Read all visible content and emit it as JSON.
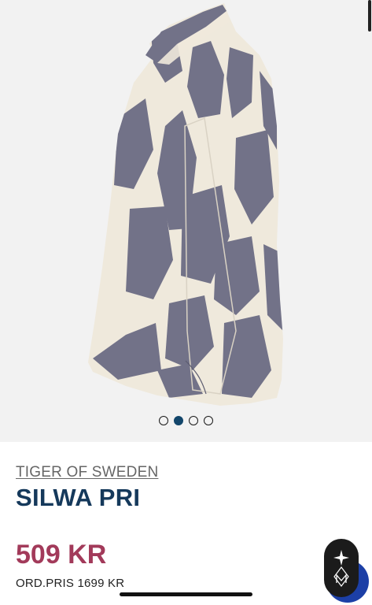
{
  "product": {
    "brand": "TIGER OF SWEDEN",
    "name": "SILWA PRI",
    "price": "509 KR",
    "original_price": "ORD.PRIS 1699 KR"
  },
  "gallery": {
    "image_count": 4,
    "active_index": 1,
    "background_color": "#f2f2f2",
    "pattern_colors": [
      "#efe9dc",
      "#727288"
    ]
  },
  "colors": {
    "title": "#15395b",
    "price": "#a23a5a",
    "accent": "#1c3fa6"
  },
  "widgets": {
    "accessibility_icon": "accessibility-icon",
    "badge_icon": "diamond-crest-icon"
  }
}
